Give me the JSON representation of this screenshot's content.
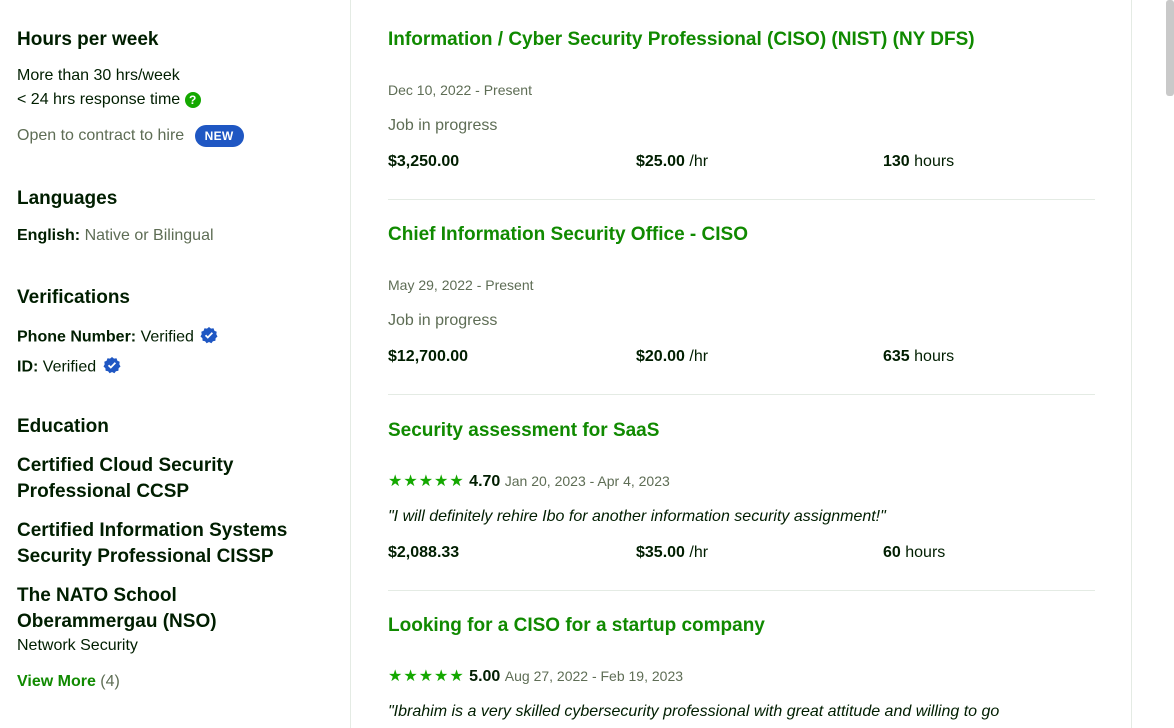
{
  "sidebar": {
    "hours_heading": "Hours per week",
    "hours_value": "More than 30 hrs/week",
    "response_time": "< 24 hrs response time",
    "help_icon_glyph": "?",
    "contract_text": "Open to contract to hire",
    "new_badge": "NEW",
    "languages_heading": "Languages",
    "languages": [
      {
        "name": "English:",
        "level": "Native or Bilingual"
      }
    ],
    "verifications_heading": "Verifications",
    "verifications": [
      {
        "label": "Phone Number:",
        "value": "Verified",
        "icon": "verified-check-icon"
      },
      {
        "label": "ID:",
        "value": "Verified",
        "icon": "verified-check-icon"
      }
    ],
    "education_heading": "Education",
    "education": [
      {
        "line1": "Certified Cloud Security",
        "line2": "Professional CCSP"
      },
      {
        "line1": "Certified Information Systems",
        "line2": "Security Professional CISSP"
      },
      {
        "line1": "The NATO School",
        "line2": "Oberammergau (NSO)",
        "sub": "Network Security"
      }
    ],
    "view_more": "View More",
    "view_more_count": "(4)"
  },
  "jobs": [
    {
      "title": "Information / Cyber Security Professional (CISO) (NIST) (NY DFS)",
      "date": "Dec 10, 2022 - Present",
      "status": "Job in progress",
      "earned": "$3,250.00",
      "rate": "$25.00",
      "rate_unit": "/hr",
      "hours": "130",
      "hours_unit": "hours"
    },
    {
      "title": "Chief Information Security Office - CISO",
      "date": "May 29, 2022 - Present",
      "status": "Job in progress",
      "earned": "$12,700.00",
      "rate": "$20.00",
      "rate_unit": "/hr",
      "hours": "635",
      "hours_unit": "hours"
    },
    {
      "title": "Security assessment for SaaS",
      "stars": "★★★★★",
      "rating": "4.70",
      "date": "Jan 20, 2023 - Apr 4, 2023",
      "feedback": "\"I will definitely rehire Ibo for another information security assignment!\"",
      "earned": "$2,088.33",
      "rate": "$35.00",
      "rate_unit": "/hr",
      "hours": "60",
      "hours_unit": "hours"
    },
    {
      "title": "Looking for a CISO for a startup company",
      "stars": "★★★★★",
      "rating": "5.00",
      "date": "Aug 27, 2022 - Feb 19, 2023",
      "feedback": "\"Ibrahim is a very skilled cybersecurity professional with great attitude and willing to go"
    }
  ],
  "colors": {
    "accent": "#14a800",
    "link": "#108a00",
    "badge": "#1f57c3",
    "text": "#001e00",
    "muted": "#5e6d55"
  }
}
